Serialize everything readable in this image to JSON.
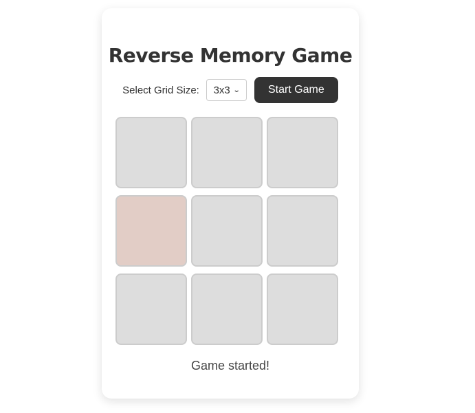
{
  "title": "Reverse Memory Game",
  "controls": {
    "grid_size_label": "Select Grid Size:",
    "grid_size_selected": "3x3",
    "start_button": "Start Game"
  },
  "grid": {
    "rows": 3,
    "cols": 3,
    "tiles": [
      {
        "state": "hidden"
      },
      {
        "state": "hidden"
      },
      {
        "state": "hidden"
      },
      {
        "state": "highlighted"
      },
      {
        "state": "hidden"
      },
      {
        "state": "hidden"
      },
      {
        "state": "hidden"
      },
      {
        "state": "hidden"
      },
      {
        "state": "hidden"
      }
    ],
    "colors": {
      "hidden": "#dddddd",
      "highlighted": "#e2cdc6"
    }
  },
  "status": "Game started!"
}
